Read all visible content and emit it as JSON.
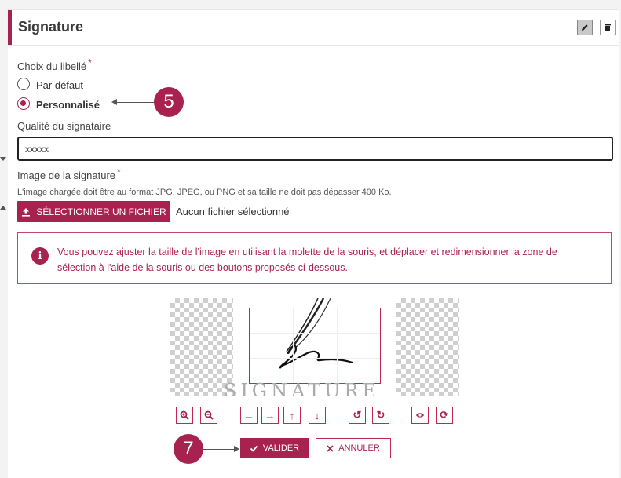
{
  "header": {
    "title": "Signature"
  },
  "label_choice": {
    "text": "Choix du libellé",
    "required": "*"
  },
  "radios": [
    {
      "label": "Par défaut",
      "selected": false
    },
    {
      "label": "Personnalisé",
      "selected": true
    }
  ],
  "signer": {
    "label": "Qualité du signataire",
    "value": "xxxxx"
  },
  "image": {
    "label": "Image de la signature",
    "required": "*",
    "hint": "L'image chargée doit être au format JPG, JPEG, ou PNG et sa taille ne doit pas dépasser 400 Ko.",
    "button_label": "SÉLECTIONNER UN FICHIER",
    "no_file": "Aucun fichier sélectionné"
  },
  "alert": {
    "icon_text": "i",
    "text": "Vous pouvez ajuster la taille de l'image en utilisant la molette de la souris, et déplacer et redimensionner la zone de sélection à l'aide de la souris ou des boutons proposés ci-dessous."
  },
  "preview": {
    "watermark": "SIGNATURE"
  },
  "toolbar": {
    "zoom_in": "zoom-in-icon",
    "zoom_out": "zoom-out-icon",
    "left": "←",
    "right": "→",
    "up": "↑",
    "down": "↓",
    "rotate_left": "↺",
    "rotate_right": "↻",
    "preview_icon": "eye-icon",
    "reset": "⟳"
  },
  "actions": {
    "validate": "VALIDER",
    "cancel": "ANNULER"
  },
  "callouts": {
    "step5": "5",
    "step7": "7"
  },
  "colors": {
    "accent": "#a8224f",
    "border": "#c0294f"
  }
}
